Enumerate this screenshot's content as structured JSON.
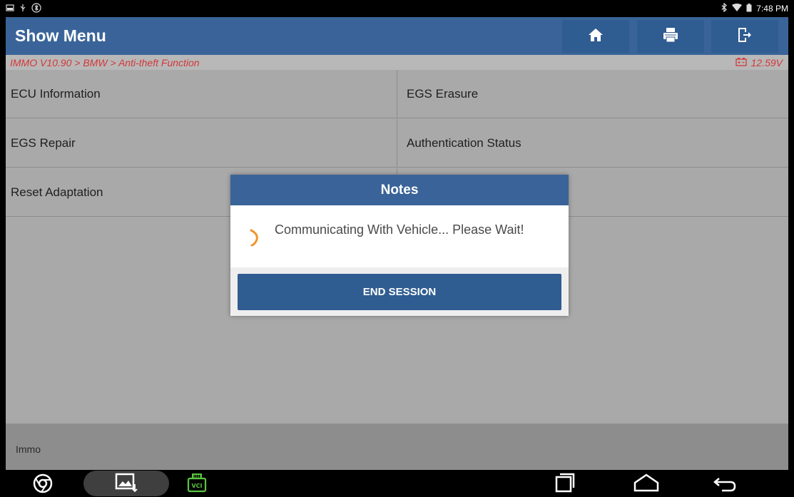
{
  "status_bar": {
    "time": "7:48 PM",
    "left_icons": [
      "notification-icon",
      "usb-icon",
      "bluetooth-scan-icon"
    ],
    "right_icons": [
      "bluetooth-icon",
      "wifi-icon",
      "battery-icon"
    ]
  },
  "header": {
    "title": "Show Menu",
    "buttons": [
      "home-icon",
      "print-icon",
      "exit-icon"
    ]
  },
  "breadcrumb": {
    "path": "IMMO V10.90 > BMW > Anti-theft Function",
    "voltage": "12.59V"
  },
  "menu": {
    "items": [
      {
        "label": "ECU Information"
      },
      {
        "label": "EGS Erasure"
      },
      {
        "label": "EGS Repair"
      },
      {
        "label": "Authentication Status"
      },
      {
        "label": "Reset Adaptation"
      }
    ]
  },
  "footer": {
    "label": "Immo"
  },
  "dialog": {
    "title": "Notes",
    "message": "Communicating With Vehicle... Please Wait!",
    "button": "END SESSION"
  },
  "nav": {
    "vci_label": "VCI",
    "items": [
      "chrome-icon",
      "gallery-icon",
      "vci-icon",
      "recents-icon",
      "home-nav-icon",
      "back-icon"
    ]
  },
  "colors": {
    "header_blue": "#3a6499",
    "accent_red": "#d2383a",
    "spinner_orange": "#f0962c"
  }
}
